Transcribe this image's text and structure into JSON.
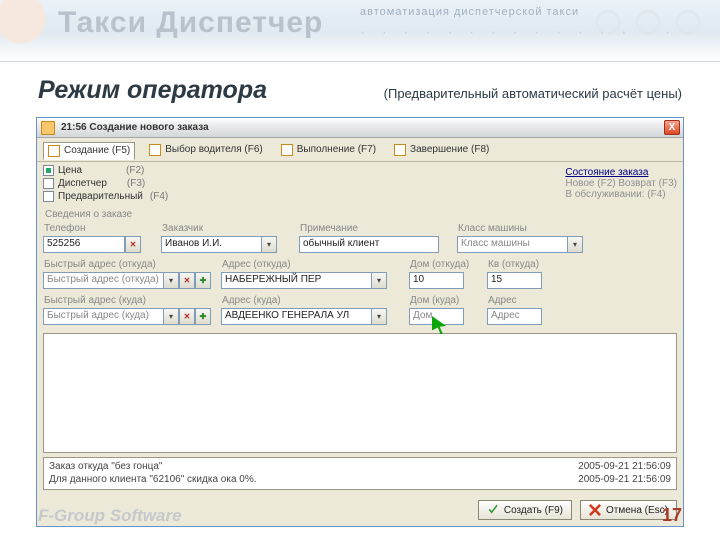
{
  "banner": {
    "title": "Такси Диспетчер",
    "subtitle": "автоматизация диспетчерской такси"
  },
  "page": {
    "heading": "Режим оператора",
    "note": "(Предварительный автоматический расчёт цены)"
  },
  "win": {
    "title": "21:56 Создание нового заказа",
    "tabs": {
      "create": "Создание (F5)",
      "driver": "Выбор водителя (F6)",
      "exec": "Выполнение (F7)",
      "finish": "Завершение (F8)"
    },
    "checks": {
      "price": "Цена",
      "priceHot": "(F2)",
      "discount": "Диспетчер",
      "discountHot": "(F3)",
      "preset": "Предварительный",
      "presetHot": "(F4)"
    },
    "status": {
      "title": "Состояние заказа",
      "line1": "Новое   (F2)   Возврат  (F3)",
      "line2": "В обслуживании:          (F4)"
    },
    "section": "Сведения о заказе",
    "f": {
      "phoneL": "Телефон",
      "phoneV": "525256",
      "custL": "Заказчик",
      "custV": "Иванов И.И.",
      "noteL": "Примечание",
      "noteV": "обычный клиент",
      "carL": "Класс машины",
      "carV": "Класс машины",
      "fromQL": "Быстрый адрес (откуда)",
      "fromQV": "Быстрый адрес (откуда)",
      "fromAL": "Адрес (откуда)",
      "fromAV": "НАБЕРЕЖНЫЙ ПЕР",
      "fromHL": "Дом (откуда)",
      "fromHV": "10",
      "fromKL": "Кв (откуда)",
      "fromKV": "15",
      "toQL": "Быстрый адрес (куда)",
      "toQV": "Быстрый адрес (куда)",
      "toAL": "Адрес (куда)",
      "toAV": "АВДЕЕНКО ГЕНЕРАЛА УЛ",
      "toHL": "Дом (куда)",
      "toHV": "Дом",
      "toKL": "Адрес",
      "toKV": "Адрес"
    },
    "log": {
      "l1": "Заказ откуда \"без гонца\"",
      "l2": "Для данного клиента \"62106\" скидка ока 0%.",
      "t1": "2005-09-21 21:56:09",
      "t2": "2005-09-21 21:56:09"
    },
    "btn": {
      "ok": "Создать (F9)",
      "cancel": "Отмена (Esc)"
    }
  },
  "footer": {
    "vendor": "F-Group Software",
    "page": "17"
  }
}
